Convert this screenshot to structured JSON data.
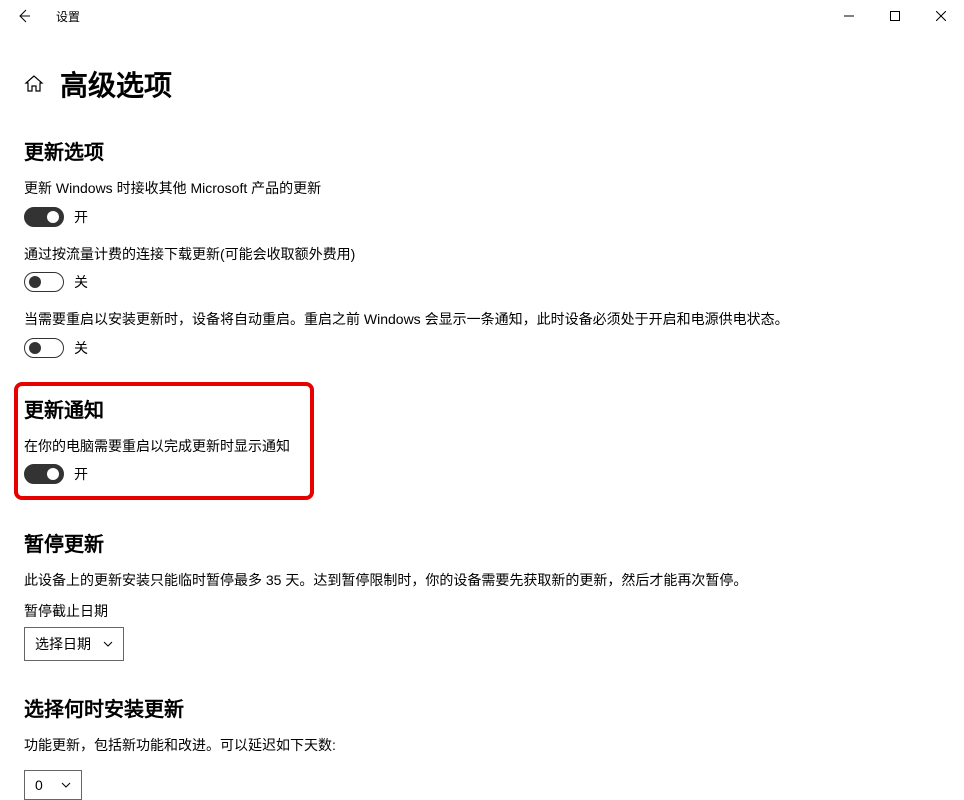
{
  "window": {
    "title": "设置"
  },
  "page": {
    "title": "高级选项"
  },
  "sections": {
    "updateOptions": {
      "title": "更新选项",
      "items": [
        {
          "desc": "更新 Windows 时接收其他 Microsoft 产品的更新",
          "state": "开",
          "on": true
        },
        {
          "desc": "通过按流量计费的连接下载更新(可能会收取额外费用)",
          "state": "关",
          "on": false
        },
        {
          "desc": "当需要重启以安装更新时，设备将自动重启。重启之前 Windows 会显示一条通知，此时设备必须处于开启和电源供电状态。",
          "state": "关",
          "on": false
        }
      ]
    },
    "updateNotifications": {
      "title": "更新通知",
      "items": [
        {
          "desc": "在你的电脑需要重启以完成更新时显示通知",
          "state": "开",
          "on": true
        }
      ]
    },
    "pauseUpdates": {
      "title": "暂停更新",
      "desc": "此设备上的更新安装只能临时暂停最多 35 天。达到暂停限制时，你的设备需要先获取新的更新，然后才能再次暂停。",
      "label": "暂停截止日期",
      "dropdown": "选择日期"
    },
    "installSchedule": {
      "title": "选择何时安装更新",
      "desc": "功能更新，包括新功能和改进。可以延迟如下天数:",
      "dropdown": "0"
    }
  }
}
